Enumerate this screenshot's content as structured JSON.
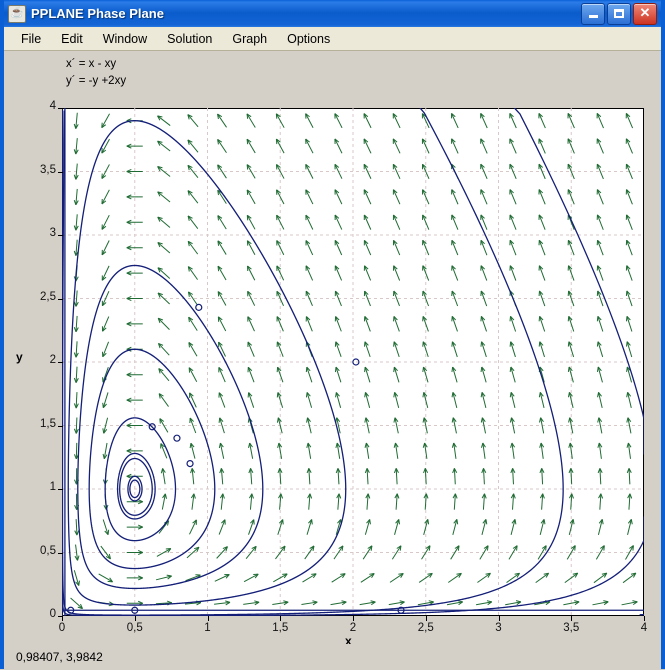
{
  "window": {
    "title": "PPLANE Phase Plane",
    "icon": "java-coffee-cup-icon",
    "buttons": {
      "minimize": "_",
      "maximize": "□",
      "close": "✕"
    }
  },
  "menubar": {
    "items": [
      {
        "label": "File"
      },
      {
        "label": "Edit"
      },
      {
        "label": "Window"
      },
      {
        "label": "Solution"
      },
      {
        "label": "Graph"
      },
      {
        "label": "Options"
      }
    ]
  },
  "equations": {
    "line1": "x´ = x - xy",
    "line2": "y´ = -y +2xy"
  },
  "statusbar": {
    "coordinates": "0,98407,  3,9842"
  },
  "chart_data": {
    "type": "scatter",
    "title": "",
    "xlabel": "x",
    "ylabel": "y",
    "xlim": [
      0,
      4
    ],
    "ylim": [
      0,
      4
    ],
    "grid": true,
    "legend": null,
    "xticks": [
      "0",
      "0,5",
      "1",
      "1,5",
      "2",
      "2,5",
      "3",
      "3,5",
      "4"
    ],
    "xtick_values": [
      0,
      0.5,
      1,
      1.5,
      2,
      2.5,
      3,
      3.5,
      4
    ],
    "yticks": [
      "0",
      "0,5",
      "1",
      "1,5",
      "2",
      "2,5",
      "3",
      "3,5",
      "4"
    ],
    "ytick_values": [
      0,
      0.5,
      1,
      1.5,
      2,
      2.5,
      3,
      3.5,
      4
    ],
    "system": {
      "xprime": "x - xy",
      "yprime": "-y + 2xy",
      "equilibrium_center": [
        0.5,
        1.0
      ],
      "equilibrium_saddle": [
        0.0,
        0.0
      ]
    },
    "vector_field": {
      "color": "#1f6b33",
      "grid_nx": 20,
      "grid_ny": 20,
      "arrow_scale": 0.33
    },
    "trajectory_color": "#141f78",
    "trajectories": [
      {
        "name": "center-orbit-tiny",
        "type": "closed",
        "cx": 0.5,
        "cy": 1.0,
        "rx": 0.035,
        "ry": 0.075,
        "skew": 0.0
      },
      {
        "name": "orbit-small",
        "type": "closed",
        "cx": 0.53,
        "cy": 1.02,
        "rx": 0.33,
        "ry": 0.52,
        "skew": 0.16
      },
      {
        "name": "orbit-small-2",
        "type": "closed",
        "cx": 0.54,
        "cy": 1.03,
        "rx": 0.36,
        "ry": 0.58,
        "skew": 0.18
      },
      {
        "name": "orbit-medium",
        "type": "closed",
        "cx": 0.6,
        "cy": 1.12,
        "rx": 0.5,
        "ry": 0.82,
        "skew": 0.28
      },
      {
        "name": "orbit-large",
        "type": "closed",
        "cx": 0.8,
        "cy": 1.35,
        "rx": 0.82,
        "ry": 1.45,
        "skew": 0.46
      },
      {
        "name": "orbit-xlarge",
        "type": "closed",
        "cx": 1.05,
        "cy": 1.7,
        "rx": 1.05,
        "ry": 2.1,
        "skew": 0.55
      },
      {
        "name": "orbit-huge",
        "type": "closed",
        "cx": 1.55,
        "cy": 2.05,
        "rx": 1.52,
        "ry": 2.55,
        "skew": 0.62
      },
      {
        "name": "y-axis-separatrix",
        "type": "vertical-line",
        "x": 0.0
      },
      {
        "name": "x-axis-separatrix",
        "type": "horizontal-line",
        "y": 0.0
      }
    ],
    "markers": [
      {
        "x": 0.06,
        "y": 0.045
      },
      {
        "x": 0.5,
        "y": 0.045
      },
      {
        "x": 2.33,
        "y": 0.045
      },
      {
        "x": 0.94,
        "y": 2.43
      },
      {
        "x": 2.02,
        "y": 2.0
      },
      {
        "x": 0.79,
        "y": 1.4
      },
      {
        "x": 0.62,
        "y": 1.49
      },
      {
        "x": 0.88,
        "y": 1.2
      }
    ]
  }
}
